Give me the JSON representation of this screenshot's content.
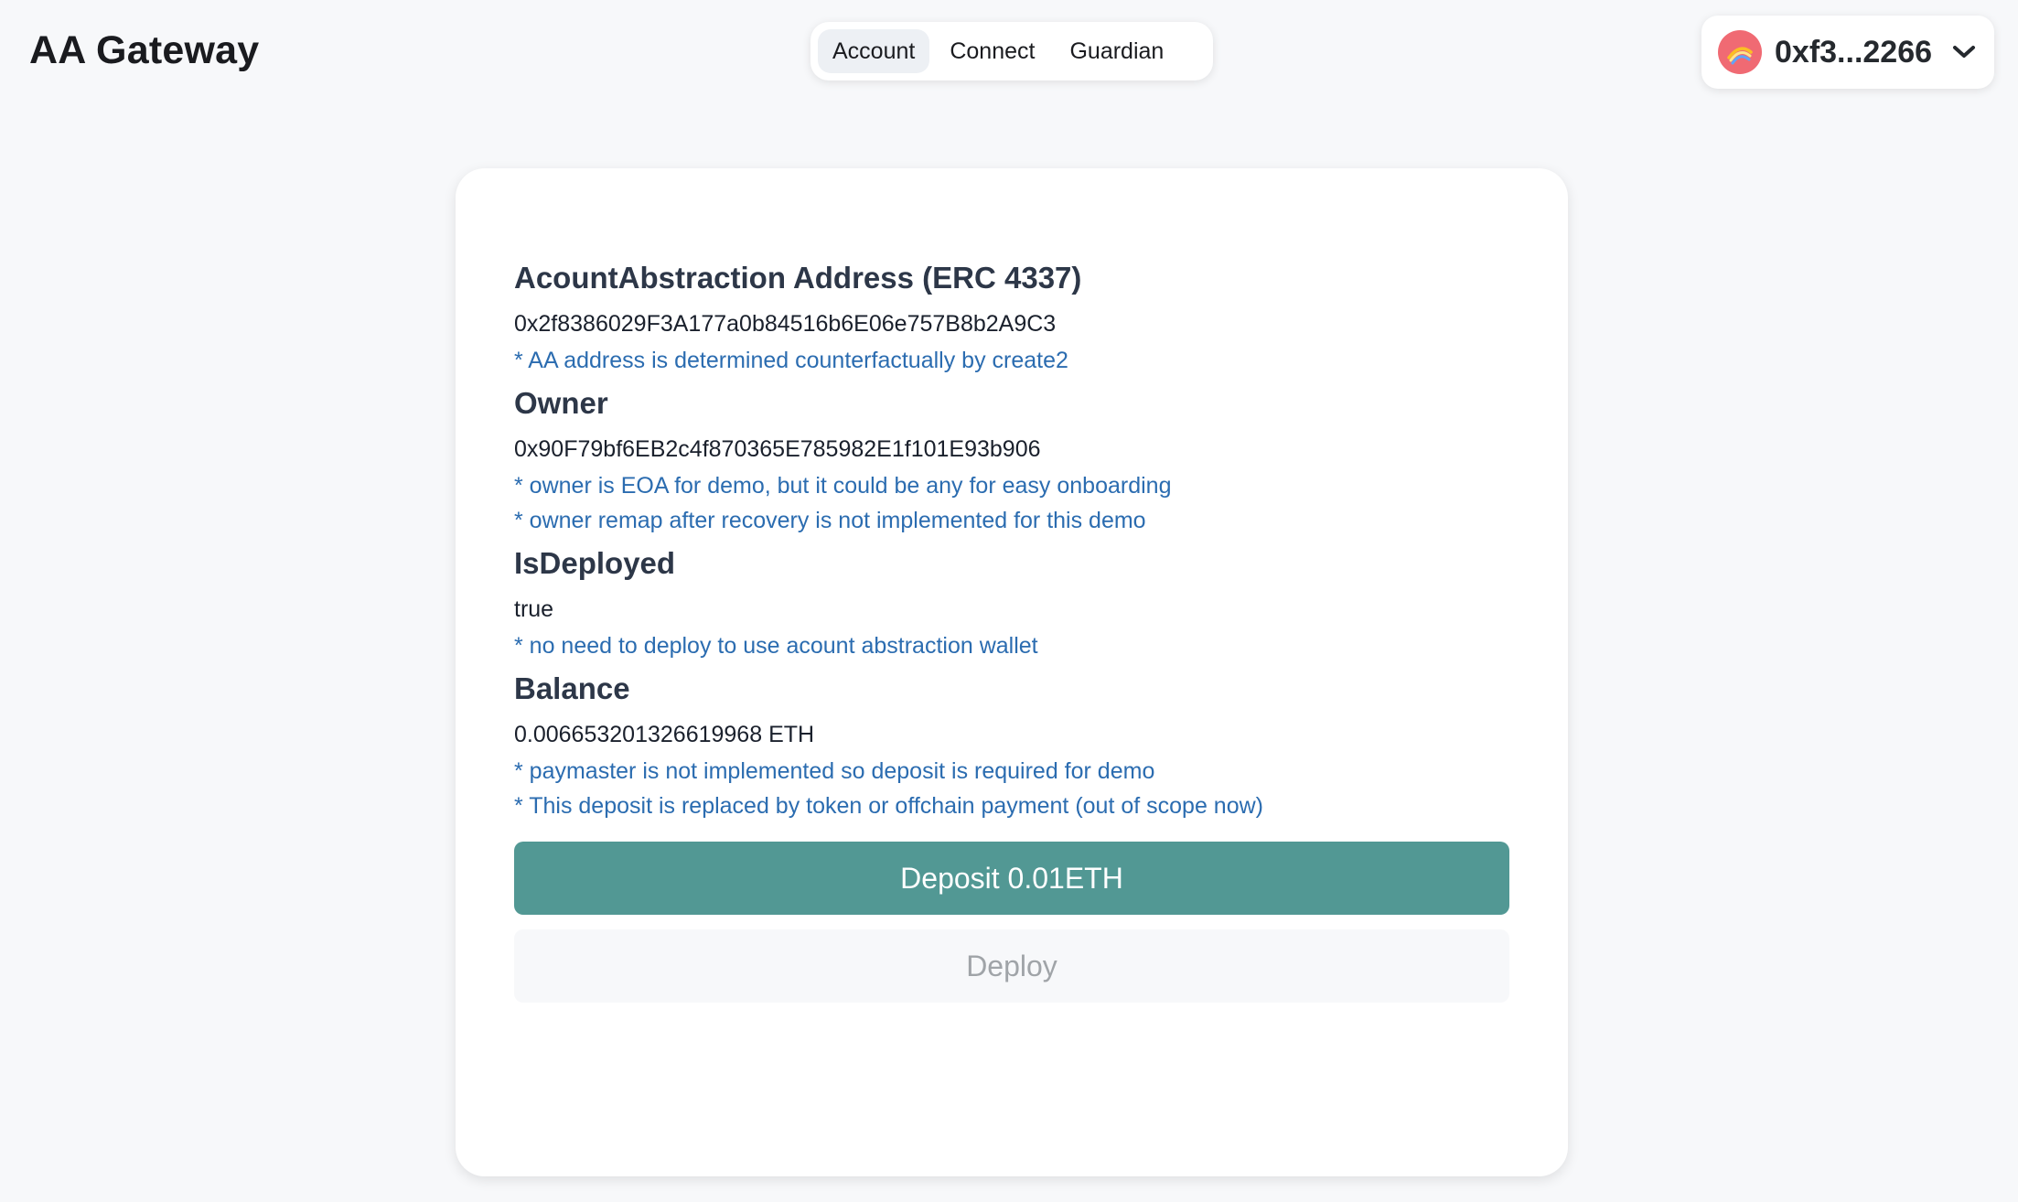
{
  "app": {
    "title": "AA Gateway"
  },
  "nav": {
    "tabs": [
      {
        "label": "Account",
        "active": true
      },
      {
        "label": "Connect",
        "active": false
      },
      {
        "label": "Guardian",
        "active": false
      }
    ]
  },
  "wallet": {
    "address_short": "0xf3...2266",
    "avatar_icon": "rainbow-icon",
    "chevron_icon": "chevron-down-icon",
    "avatar_color": "#f06a73"
  },
  "card": {
    "aa_address": {
      "heading": "AcountAbstraction Address (ERC 4337)",
      "value": "0x2f8386029F3A177a0b84516b6E06e757B8b2A9C3",
      "notes": [
        "* AA address is determined counterfactually by create2"
      ]
    },
    "owner": {
      "heading": "Owner",
      "value": "0x90F79bf6EB2c4f870365E785982E1f101E93b906",
      "notes": [
        "* owner is EOA for demo, but it could be any for easy onboarding",
        "* owner remap after recovery is not implemented for this demo"
      ]
    },
    "is_deployed": {
      "heading": "IsDeployed",
      "value": "true",
      "notes": [
        "* no need to deploy to use acount abstraction wallet"
      ]
    },
    "balance": {
      "heading": "Balance",
      "value": "0.006653201326619968 ETH",
      "notes": [
        "* paymaster is not implemented so deposit is required for demo",
        "* This deposit is replaced by token or offchain payment (out of scope now)"
      ]
    },
    "deposit_button": "Deposit 0.01ETH",
    "deploy_button": "Deploy"
  },
  "colors": {
    "background": "#f7f8fa",
    "accent": "#529894",
    "note": "#2b6cb0",
    "heading": "#2d3748"
  }
}
